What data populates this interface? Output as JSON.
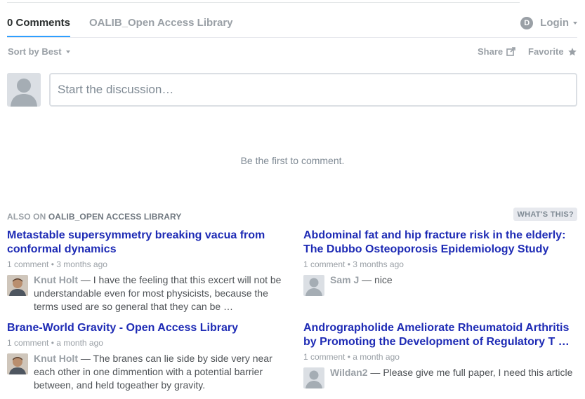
{
  "nav": {
    "comments_tab": "0 Comments",
    "community_tab": "OALIB_Open Access Library",
    "login_label": "Login",
    "disqus_letter": "D"
  },
  "toolbar": {
    "sort_label": "Sort by Best",
    "share_label": "Share",
    "favorite_label": "Favorite"
  },
  "composer": {
    "placeholder": "Start the discussion…"
  },
  "empty_message": "Be the first to comment.",
  "also_on": {
    "prefix": "ALSO ON",
    "site": "OALIB_OPEN ACCESS LIBRARY",
    "whats_this": "WHAT'S THIS?",
    "cards": [
      {
        "title": "Metastable supersymmetry breaking vacua from conformal dynamics",
        "meta": "1 comment • 3 months ago",
        "author": "Knut Holt",
        "excerpt": " — I have the feeling that this excert will not be understandable even for most physicists, because the terms used are so general that they can be …"
      },
      {
        "title": "Abdominal fat and hip fracture risk in the elderly: The Dubbo Osteoporosis Epidemiology Study",
        "meta": "1 comment • 3 months ago",
        "author": "Sam J",
        "excerpt": " — nice"
      },
      {
        "title": "Brane-World Gravity - Open Access Library",
        "meta": "1 comment • a month ago",
        "author": "Knut Holt",
        "excerpt": " — The branes can lie side by side very near each other in one dimmention with a potential barrier between, and held togeather by gravity."
      },
      {
        "title": "Andrographolide Ameliorate Rheumatoid Arthritis by Promoting the Development of Regulatory T …",
        "meta": "1 comment • a month ago",
        "author": "Wildan2",
        "excerpt": " — Please give me full paper, I need this article"
      }
    ]
  },
  "colors": {
    "link_blue": "#1e2bb5",
    "tab_underline": "#2e9fff",
    "muted_gray": "#9aa0a6"
  }
}
